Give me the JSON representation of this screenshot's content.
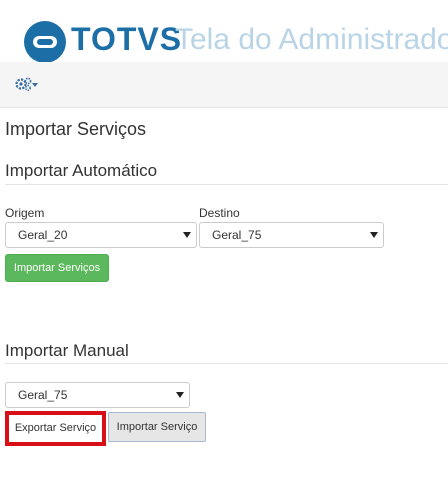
{
  "header": {
    "brand": "TOTVS",
    "app_title": "Tela do Administrador",
    "brand_color": "#1c6fa6",
    "title_color": "#b9d4e6"
  },
  "navbar": {
    "menu_icon": "gears-icon"
  },
  "page": {
    "title": "Importar Serviços"
  },
  "auto_import": {
    "heading": "Importar Automático",
    "origin_label": "Origem",
    "origin_value": "Geral_20",
    "destination_label": "Destino",
    "destination_value": "Geral_75",
    "import_button": "Importar Serviços",
    "button_color": "#5cb85c"
  },
  "manual_import": {
    "heading": "Importar Manual",
    "select_value": "Geral_75",
    "export_button": "Exportar Serviço",
    "import_button": "Importar Serviço",
    "highlight_color": "#d80f16"
  }
}
